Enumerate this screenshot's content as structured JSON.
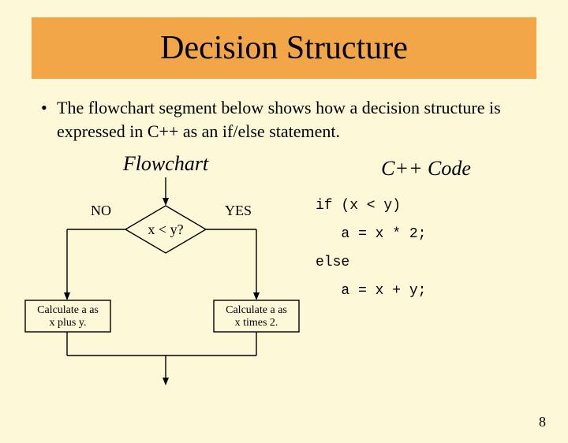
{
  "title": "Decision Structure",
  "bullet": "The flowchart segment below shows how a decision structure is expressed in C++ as an if/else statement.",
  "flow": {
    "heading": "Flowchart",
    "no": "NO",
    "yes": "YES",
    "cond": "x < y?",
    "left_box_l1": "Calculate a as",
    "left_box_l2": "x plus y.",
    "right_box_l1": "Calculate a as",
    "right_box_l2": "x times 2."
  },
  "code": {
    "heading": "C++ Code",
    "text": "if (x < y)\n   a = x * 2;\nelse\n   a = x + y;"
  },
  "page": "8"
}
